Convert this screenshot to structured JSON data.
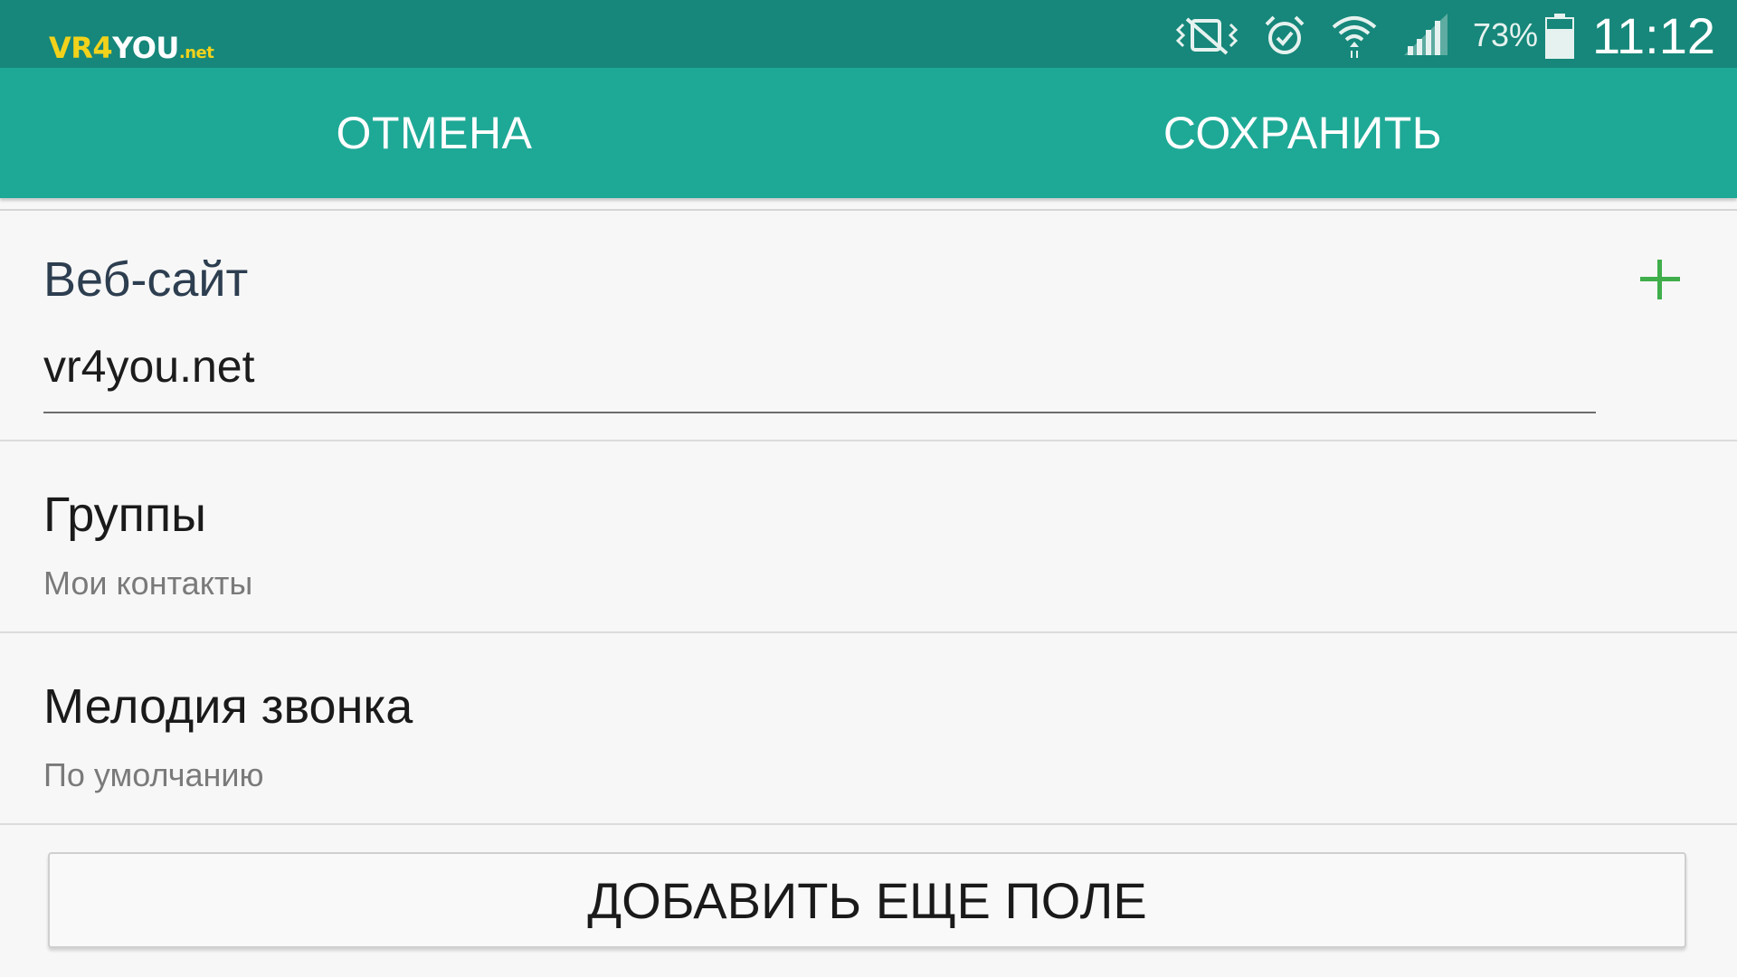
{
  "status_bar": {
    "logo": {
      "part1": "VR",
      "part2": "4",
      "part3": "YOU",
      "part4": ".net"
    },
    "icons": [
      "vibrate-mute-icon",
      "alarm-icon",
      "wifi-icon",
      "signal-icon",
      "battery-icon"
    ],
    "battery_percent": "73%",
    "battery_level": 0.73,
    "time": "11:12",
    "colors": {
      "background": "#16877a"
    }
  },
  "action_bar": {
    "cancel_label": "ОТМЕНА",
    "save_label": "СОХРАНИТЬ",
    "colors": {
      "background": "#1ea996"
    }
  },
  "website": {
    "label": "Веб-сайт",
    "value": "vr4you.net",
    "add_icon": "plus-icon",
    "accent_color": "#3fae4b"
  },
  "groups": {
    "label": "Группы",
    "value": "Мои контакты"
  },
  "ringtone": {
    "label": "Мелодия звонка",
    "value": "По умолчанию"
  },
  "add_field_button": {
    "label": "ДОБАВИТЬ ЕЩЕ ПОЛЕ"
  }
}
